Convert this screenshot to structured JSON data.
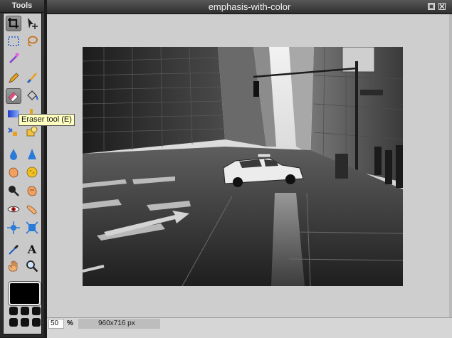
{
  "tools_panel": {
    "title": "Tools",
    "tooltip": "Eraser tool (E)",
    "active_tool": "eraser",
    "foreground_color": "#000000"
  },
  "document": {
    "title": "emphasis-with-color",
    "zoom_value": "50",
    "zoom_unit": "%",
    "dimensions": "960x716 px"
  },
  "tools": [
    {
      "name": "crop-icon"
    },
    {
      "name": "move-icon"
    },
    {
      "name": "marquee-icon"
    },
    {
      "name": "lasso-icon"
    },
    {
      "name": "magic-wand-icon"
    },
    {
      "name": "pencil-icon"
    },
    {
      "name": "brush-icon"
    },
    {
      "name": "eraser-icon"
    },
    {
      "name": "paint-bucket-icon"
    },
    {
      "name": "gradient-icon"
    },
    {
      "name": "color-replace-icon"
    },
    {
      "name": "clone-stamp-icon"
    },
    {
      "name": "shapes-icon"
    },
    {
      "name": "blur-icon"
    },
    {
      "name": "sharpen-icon"
    },
    {
      "name": "smudge-icon"
    },
    {
      "name": "sponge-icon"
    },
    {
      "name": "zoom-magnifier-icon"
    },
    {
      "name": "burn-icon"
    },
    {
      "name": "red-eye-icon"
    },
    {
      "name": "dodge-icon"
    },
    {
      "name": "bloat-icon"
    },
    {
      "name": "pinch-icon"
    },
    {
      "name": "color-picker-icon"
    },
    {
      "name": "type-icon"
    },
    {
      "name": "hand-icon"
    },
    {
      "name": "zoom-icon"
    }
  ]
}
